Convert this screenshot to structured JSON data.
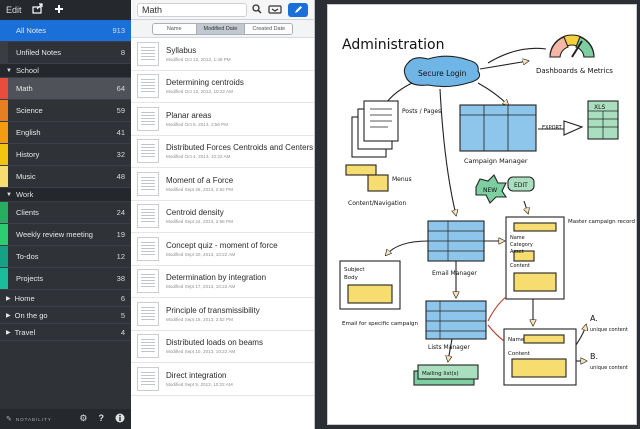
{
  "sidebar": {
    "edit_label": "Edit",
    "top_items": [
      {
        "label": "All Notes",
        "count": "913",
        "color": "#1a6fd8"
      },
      {
        "label": "Unfiled Notes",
        "count": "8",
        "color": "#3a3d42"
      }
    ],
    "sections": [
      {
        "name": "School",
        "items": [
          {
            "label": "Math",
            "count": "64",
            "color": "#e84c3d"
          },
          {
            "label": "Science",
            "count": "59",
            "color": "#e67e22"
          },
          {
            "label": "English",
            "count": "41",
            "color": "#f39c12"
          },
          {
            "label": "History",
            "count": "32",
            "color": "#f1c40f"
          },
          {
            "label": "Music",
            "count": "48",
            "color": "#f7dc6f"
          }
        ]
      },
      {
        "name": "Work",
        "items": [
          {
            "label": "Clients",
            "count": "24",
            "color": "#27ae60"
          },
          {
            "label": "Weekly review meeting",
            "count": "19",
            "color": "#2ecc71"
          },
          {
            "label": "To-dos",
            "count": "12",
            "color": "#16a085"
          },
          {
            "label": "Projects",
            "count": "38",
            "color": "#1abc9c"
          }
        ]
      }
    ],
    "collapsed": [
      {
        "label": "Home",
        "count": "6"
      },
      {
        "label": "On the go",
        "count": "5"
      },
      {
        "label": "Travel",
        "count": "4"
      }
    ],
    "brand": "NOTABILITY",
    "icons": [
      "share-icon",
      "plus-icon",
      "gear-icon",
      "help-icon",
      "info-icon"
    ]
  },
  "list": {
    "title": "Math",
    "sort_tabs": [
      {
        "label": "Name",
        "active": false
      },
      {
        "label": "Modified Date",
        "active": true
      },
      {
        "label": "Created Date",
        "active": false
      }
    ],
    "notes": [
      {
        "title": "Syllabus",
        "date": "Modified Oct 10, 2013, 1:49 PM"
      },
      {
        "title": "Determining centroids",
        "date": "Modified Oct 10, 2013, 10:22 AM"
      },
      {
        "title": "Planar areas",
        "date": "Modified Oct 8, 2013, 2:56 PM"
      },
      {
        "title": "Distributed Forces Centroids and Centers",
        "date": "Modified Oct 4, 2013, 10:22 AM"
      },
      {
        "title": "Moment of a Force",
        "date": "Modified Sept 26, 2013, 2:52 PM"
      },
      {
        "title": "Centroid density",
        "date": "Modified Sept 24, 2013, 2:56 PM"
      },
      {
        "title": "Concept quiz - moment of force",
        "date": "Modified Sept 20, 2013, 10:22 AM"
      },
      {
        "title": "Determination by integration",
        "date": "Modified Sept 17, 2013, 10:22 AM"
      },
      {
        "title": "Principle of transmissibility",
        "date": "Modified Sept 16, 2013, 2:52 PM"
      },
      {
        "title": "Distributed loads on beams",
        "date": "Modified Sept 10, 2013, 10:22 AM"
      },
      {
        "title": "Direct integration",
        "date": "Modified Sept 5, 2013, 10:22 AM"
      }
    ]
  },
  "canvas": {
    "title": "Administration",
    "secure_login": "Secure Login",
    "dashboards": "Dashboards & Metrics",
    "posts_pages": "Posts / Pages",
    "xls": "XLS",
    "export": "EXPORT",
    "campaign_manager": "Campaign Manager",
    "menus": "Menus",
    "content_navigation": "Content/Navigation",
    "new": "NEW",
    "edit": "EDIT",
    "master_campaign": "Master campaign record",
    "name": "Name",
    "category": "Category",
    "asset": "Asset",
    "content": "Content",
    "subject": "Subject",
    "body": "Body",
    "email_manager": "Email Manager",
    "email_specific": "Email for specific campaign",
    "lists_manager": "Lists Manager",
    "mailing": "Mailing list(s)",
    "a_label": "A.",
    "a_text": "unique content",
    "b_label": "B.",
    "b_text": "unique content",
    "name2": "Name",
    "content2": "Content"
  }
}
